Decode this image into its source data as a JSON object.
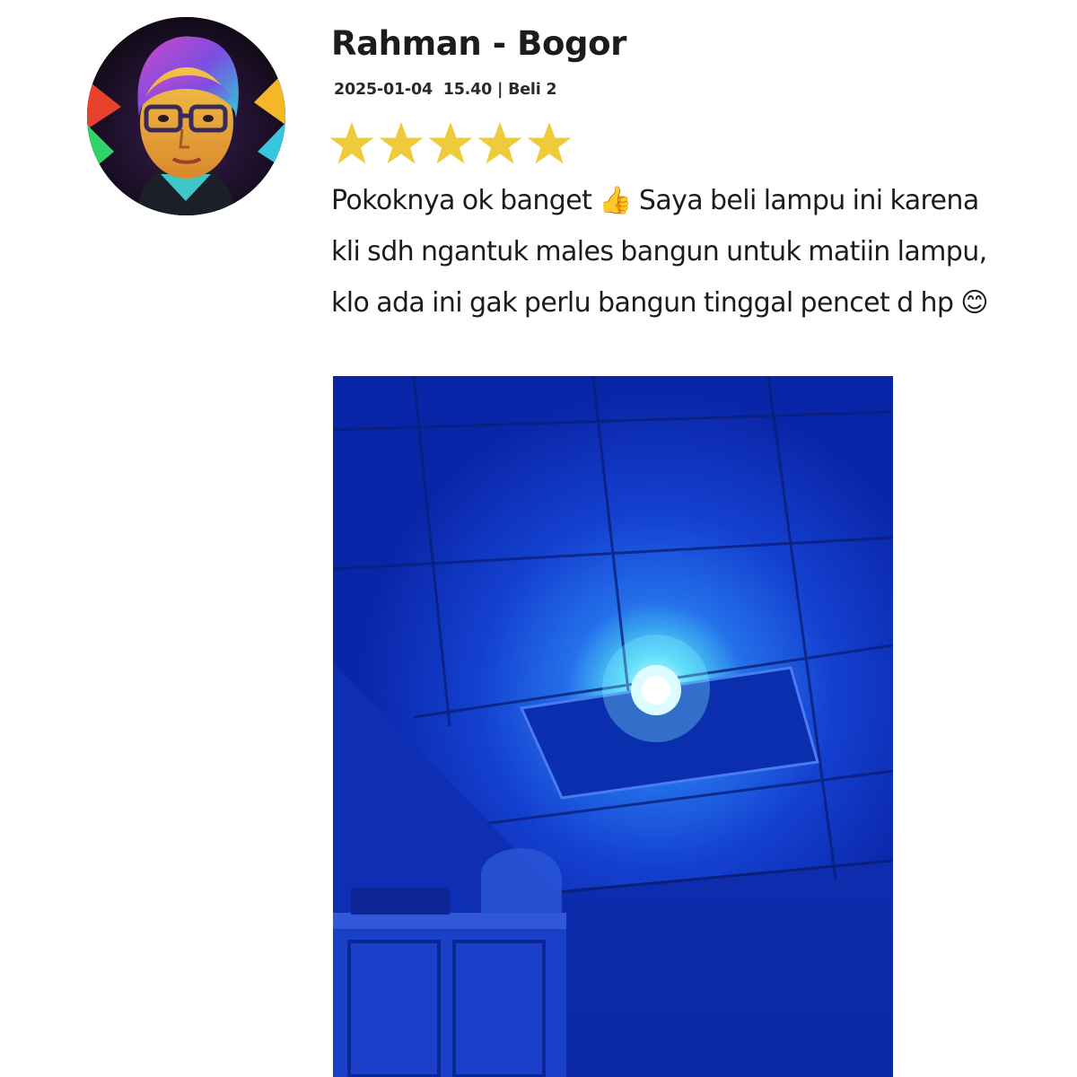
{
  "review": {
    "author": "Rahman - Bogor",
    "date_time": "2025-01-04  15.40",
    "separator": "|",
    "purchase": "Beli 2",
    "rating": {
      "value": 5,
      "max": 5
    },
    "text": "Pokoknya ok banget 👍 Saya beli lampu ini karena kli sdh ngantuk males bangun untuk matiin lampu, klo ada ini gak perlu bangun tinggal pencet d hp 😊"
  },
  "avatar_icon": "illustrated-man-with-glasses-avatar",
  "photo_icon": "blue-ceiling-lamp-photo",
  "colors": {
    "star": "#EFCB3B",
    "photo_blue": "#0C2FB8",
    "text": "#1C1C1C"
  }
}
